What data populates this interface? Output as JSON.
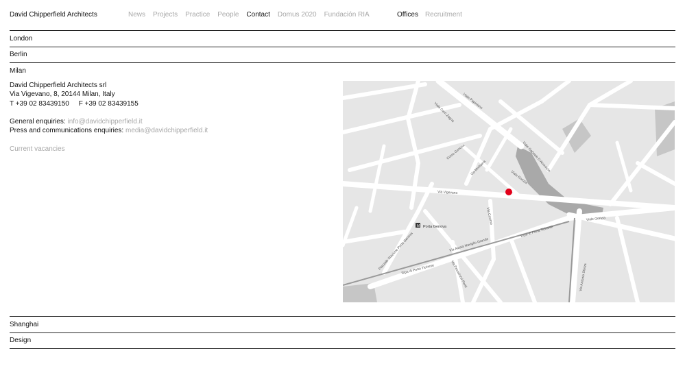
{
  "brand": "David Chipperfield Architects",
  "nav": {
    "main": [
      {
        "label": "News",
        "active": false
      },
      {
        "label": "Projects",
        "active": false
      },
      {
        "label": "Practice",
        "active": false
      },
      {
        "label": "People",
        "active": false
      },
      {
        "label": "Contact",
        "active": true
      },
      {
        "label": "Domus 2020",
        "active": false
      },
      {
        "label": "Fundación RIA",
        "active": false
      }
    ],
    "sub": [
      {
        "label": "Offices",
        "active": true
      },
      {
        "label": "Recruitment",
        "active": false
      }
    ]
  },
  "offices": {
    "london": "London",
    "berlin": "Berlin",
    "milan": "Milan",
    "shanghai": "Shanghai",
    "design": "Design"
  },
  "milan_office": {
    "company": "David Chipperfield Architects srl",
    "address": "Via Vigevano, 8, 20144 Milan, Italy",
    "phone_fax": "T +39 02 83439150     F +39 02 83439155",
    "general_label": "General enquiries:",
    "general_email": "info@davidchipperfield.it",
    "press_label": "Press and communications enquiries:",
    "press_email": "media@davidchipperfield.it",
    "vacancies": "Current vacancies"
  },
  "map": {
    "marker_color": "#e2001a",
    "labels": {
      "viale_papiniano": "Viale Papiniano",
      "via_cerri": "Viale Cerri Zagna",
      "corso_genova": "Corso Genova",
      "via_morbarra": "Via Morbarra",
      "viale_gorizia": "Viale Gorizia",
      "viale_dannunzio": "Viale Gabriele D'Annunzio",
      "via_vigevano": "Via Vigevano",
      "via_cosimo": "Via Cosimo",
      "porta_genova": "Porta Genova",
      "piazzale_stazione": "Piazzale Stazione Porta Genova",
      "alzaia": "Via Alzaia Naviglio Grande",
      "ripa_1": "Ripa di Porta Ticinese",
      "ripa_2": "Ripa di Porta Ticinese",
      "via_pesce": "Via Pestalozzi Penti",
      "viale_gorizia_2": "Viale Gorizia",
      "via_argelati": "Via Antonio Sforza"
    }
  }
}
